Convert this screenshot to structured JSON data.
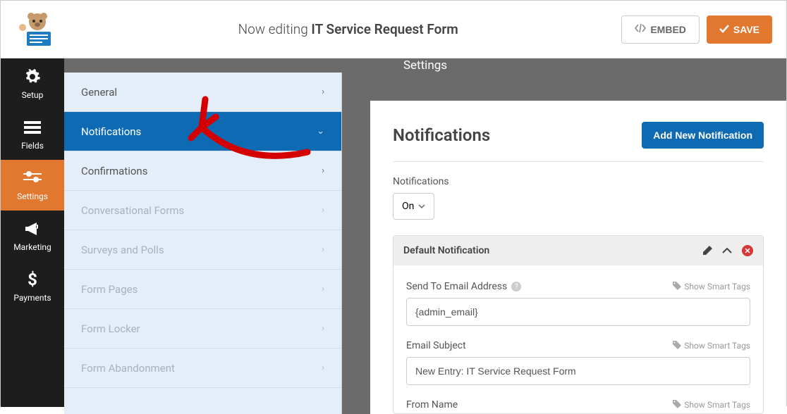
{
  "header": {
    "title_prefix": "Now editing ",
    "title_strong": "IT Service Request Form",
    "embed_label": "EMBED",
    "save_label": "SAVE"
  },
  "nav": {
    "items": [
      {
        "label": "Setup"
      },
      {
        "label": "Fields"
      },
      {
        "label": "Settings"
      },
      {
        "label": "Marketing"
      },
      {
        "label": "Payments"
      }
    ]
  },
  "sub_header": "Settings",
  "settings_menu": [
    {
      "label": "General",
      "chev": "›"
    },
    {
      "label": "Notifications",
      "chev": "⌄"
    },
    {
      "label": "Confirmations",
      "chev": "›"
    },
    {
      "label": "Conversational Forms",
      "chev": "›"
    },
    {
      "label": "Surveys and Polls",
      "chev": "›"
    },
    {
      "label": "Form Pages",
      "chev": "›"
    },
    {
      "label": "Form Locker",
      "chev": "›"
    },
    {
      "label": "Form Abandonment",
      "chev": "›"
    }
  ],
  "panel": {
    "title": "Notifications",
    "add_button": "Add New Notification",
    "toggle_label": "Notifications",
    "toggle_value": "On",
    "card_title": "Default Notification",
    "fields": [
      {
        "label": "Send To Email Address",
        "value": "{admin_email}",
        "smart": "Show Smart Tags",
        "help": true
      },
      {
        "label": "Email Subject",
        "value": "New Entry: IT Service Request Form",
        "smart": "Show Smart Tags",
        "help": false
      },
      {
        "label": "From Name",
        "value": "",
        "smart": "Show Smart Tags",
        "help": false
      }
    ]
  },
  "colors": {
    "accent": "#e27730",
    "blue": "#0e6bb3"
  }
}
